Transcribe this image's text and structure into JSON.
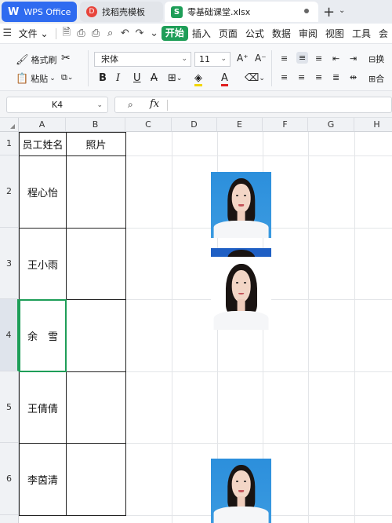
{
  "tabs": {
    "app": "WPS Office",
    "templates": "找稻壳模板",
    "file": "零基础课堂.xlsx"
  },
  "menu": {
    "file": "文件",
    "items": [
      "开始",
      "插入",
      "页面",
      "公式",
      "数据",
      "审阅",
      "视图",
      "工具",
      "会"
    ]
  },
  "ribbon": {
    "format_painter": "格式刷",
    "paste": "粘贴",
    "font_name": "宋体",
    "font_size": "11",
    "wrap": "换",
    "merge": "合"
  },
  "formula_bar": {
    "name_box": "K4",
    "fx": "fx",
    "value": ""
  },
  "sheet": {
    "columns": [
      "A",
      "B",
      "C",
      "D",
      "E",
      "F",
      "G",
      "H"
    ],
    "rows": [
      "1",
      "2",
      "3",
      "4",
      "5",
      "6"
    ],
    "headers": [
      "员工姓名",
      "照片"
    ],
    "names": [
      "程心怡",
      "王小雨",
      "余　雪",
      "王倩倩",
      "李茵清"
    ]
  },
  "colors": {
    "accent": "#1e9e58",
    "wps_blue": "#2f6bf0",
    "photo_blue": "#2c8fdc"
  }
}
